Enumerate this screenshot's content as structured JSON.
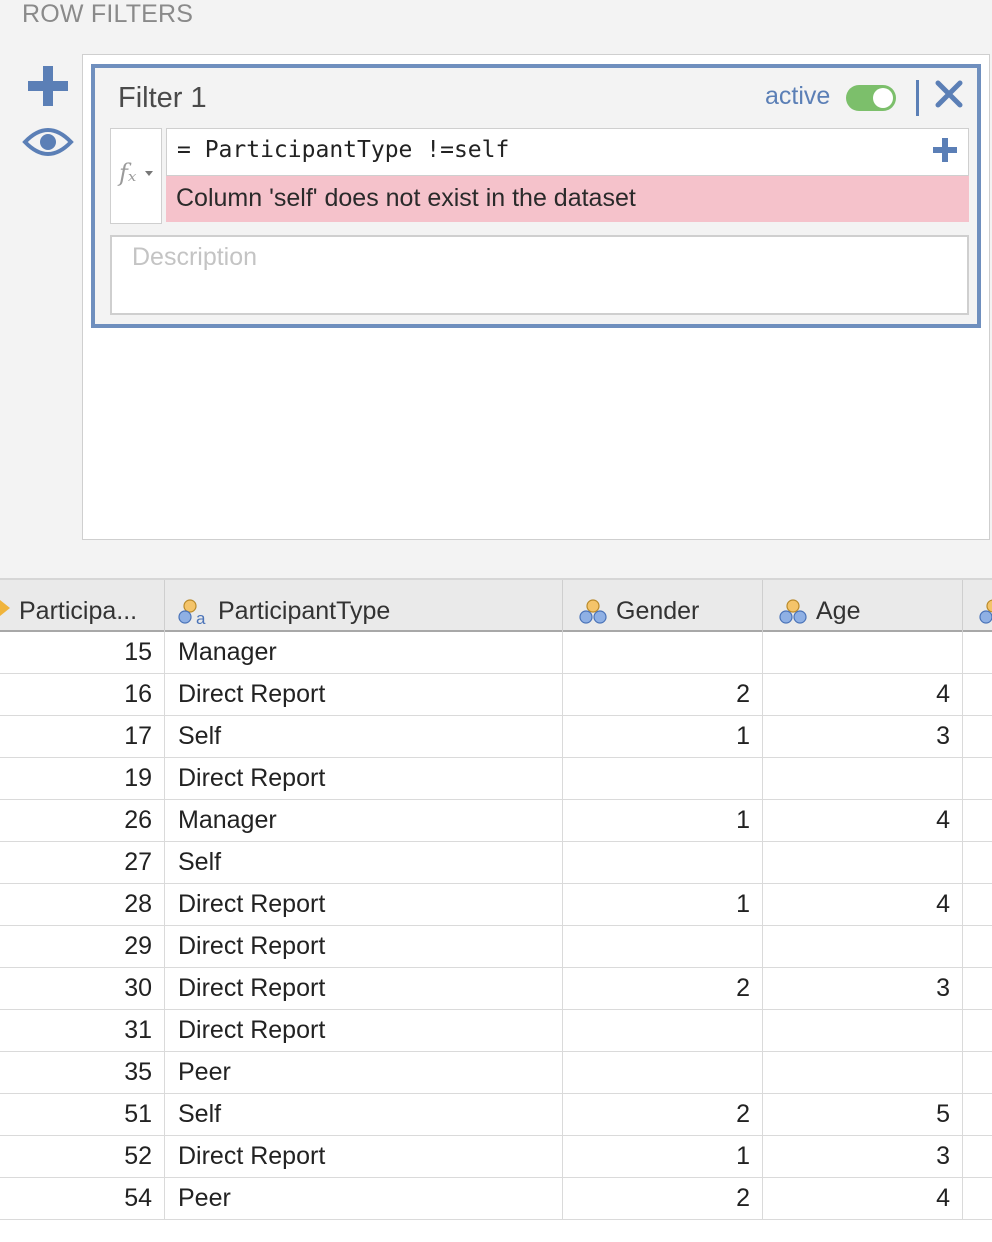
{
  "section_title": "ROW FILTERS",
  "filter": {
    "name": "Filter 1",
    "active_label": "active",
    "active": true,
    "formula": "= ParticipantType !=self",
    "error": "Column 'self' does not exist in the dataset",
    "description_placeholder": "Description",
    "fx_label": "fx"
  },
  "colors": {
    "accent": "#5b7fb6",
    "toggle_on": "#7cbf6b",
    "error_bg": "#f5c2cb"
  },
  "table": {
    "columns": [
      {
        "name": "Participa...",
        "icon": "key-variable-icon"
      },
      {
        "name": "ParticipantType",
        "icon": "nominal-text-variable-icon"
      },
      {
        "name": "Gender",
        "icon": "nominal-variable-icon"
      },
      {
        "name": "Age",
        "icon": "nominal-variable-icon"
      }
    ],
    "rows": [
      [
        "15",
        "Manager",
        "",
        ""
      ],
      [
        "16",
        "Direct Report",
        "2",
        "4"
      ],
      [
        "17",
        "Self",
        "1",
        "3"
      ],
      [
        "19",
        "Direct Report",
        "",
        ""
      ],
      [
        "26",
        "Manager",
        "1",
        "4"
      ],
      [
        "27",
        "Self",
        "",
        ""
      ],
      [
        "28",
        "Direct Report",
        "1",
        "4"
      ],
      [
        "29",
        "Direct Report",
        "",
        ""
      ],
      [
        "30",
        "Direct Report",
        "2",
        "3"
      ],
      [
        "31",
        "Direct Report",
        "",
        ""
      ],
      [
        "35",
        "Peer",
        "",
        ""
      ],
      [
        "51",
        "Self",
        "2",
        "5"
      ],
      [
        "52",
        "Direct Report",
        "1",
        "3"
      ],
      [
        "54",
        "Peer",
        "2",
        "4"
      ]
    ]
  }
}
